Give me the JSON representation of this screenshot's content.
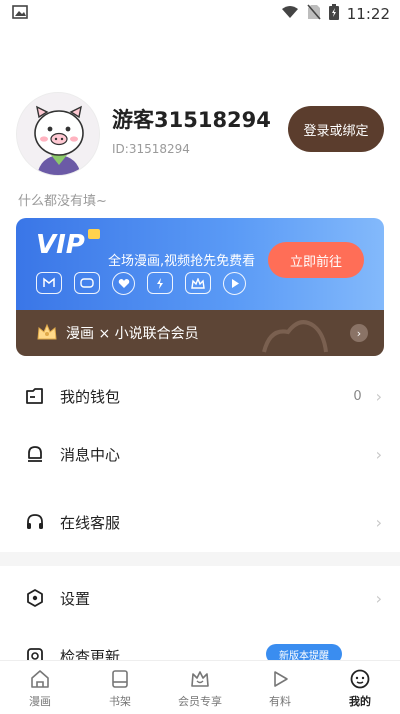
{
  "status_bar": {
    "time": "11:22"
  },
  "profile": {
    "username": "游客31518294",
    "user_id": "ID:31518294",
    "login_button": "登录或绑定",
    "bio": "什么都没有填~"
  },
  "vip": {
    "logo": "VIP",
    "description": "全场漫画,视频抢先免费看",
    "go_button": "立即前往",
    "benefit_icons": [
      "comic-icon",
      "bubble-icon",
      "heart-icon",
      "lightning-icon",
      "crown-icon",
      "play-icon"
    ],
    "bottom_text": "漫画 × 小说联合会员",
    "bottom_arrow": "›",
    "colors": {
      "card_top": "#3a76e7",
      "card_bottom": "#5d4536",
      "go_button": "#ff6e57"
    }
  },
  "menu": {
    "wallet": {
      "label": "我的钱包",
      "value": "0"
    },
    "messages": {
      "label": "消息中心"
    },
    "service": {
      "label": "在线客服"
    },
    "settings": {
      "label": "设置"
    },
    "update": {
      "label": "检查更新",
      "badge": "新版本提醒"
    },
    "chevron": "›"
  },
  "tabs": [
    {
      "label": "漫画",
      "icon": "home-icon"
    },
    {
      "label": "书架",
      "icon": "bookshelf-icon"
    },
    {
      "label": "会员专享",
      "icon": "vip-icon"
    },
    {
      "label": "有料",
      "icon": "play-icon"
    },
    {
      "label": "我的",
      "icon": "profile-icon",
      "active": true
    }
  ]
}
